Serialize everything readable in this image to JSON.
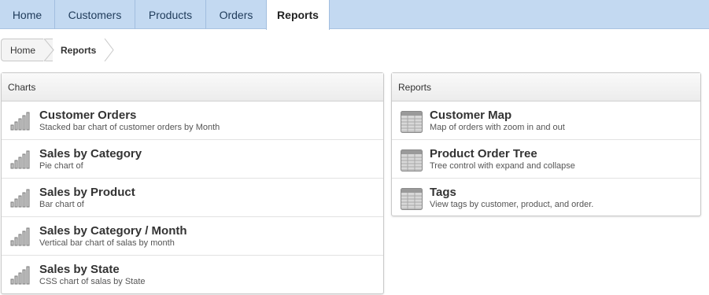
{
  "tabs": [
    {
      "label": "Home"
    },
    {
      "label": "Customers"
    },
    {
      "label": "Products"
    },
    {
      "label": "Orders"
    },
    {
      "label": "Reports",
      "active": true
    }
  ],
  "breadcrumb": [
    "Home",
    "Reports"
  ],
  "charts_panel": {
    "title": "Charts",
    "icon": "bar-chart-icon",
    "items": [
      {
        "title": "Customer Orders",
        "desc": "Stacked bar chart of customer orders by Month"
      },
      {
        "title": "Sales by Category",
        "desc": "Pie chart of"
      },
      {
        "title": "Sales by Product",
        "desc": "Bar chart of"
      },
      {
        "title": "Sales by Category / Month",
        "desc": "Vertical bar chart of salas by month"
      },
      {
        "title": "Sales by State",
        "desc": "CSS chart of salas by State"
      }
    ]
  },
  "reports_panel": {
    "title": "Reports",
    "icon": "table-icon",
    "items": [
      {
        "title": "Customer Map",
        "desc": "Map of orders with zoom in and out"
      },
      {
        "title": "Product Order Tree",
        "desc": "Tree control with expand and collapse"
      },
      {
        "title": "Tags",
        "desc": "View tags by customer, product, and order."
      }
    ]
  },
  "colors": {
    "tabbar_bg": "#c3d9f1",
    "tab_text": "#1f3b5a",
    "panel_header_bg": "#ececec"
  }
}
